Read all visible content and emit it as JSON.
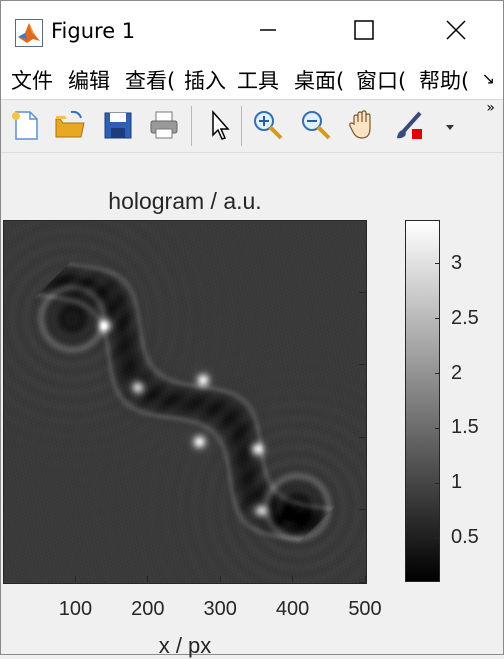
{
  "window": {
    "title": "Figure 1"
  },
  "menubar": {
    "items": [
      "文件",
      "编辑",
      "查看(",
      "插入",
      "工具",
      "桌面(",
      "窗口(",
      "帮助("
    ],
    "more_label": "↘"
  },
  "toolbar": {
    "tools": [
      "new-figure-icon",
      "open-file-icon",
      "save-icon",
      "print-icon",
      "pointer-icon",
      "zoom-in-icon",
      "zoom-out-icon",
      "pan-hand-icon",
      "brush-icon",
      "dropdown-arrow-icon"
    ],
    "more_label": "»"
  },
  "plot": {
    "title": "hologram / a.u.",
    "xlabel": "x / px",
    "x_tick_labels": [
      "100",
      "200",
      "300",
      "400",
      "500"
    ],
    "colorbar_tick_labels": [
      "0.5",
      "1",
      "1.5",
      "2",
      "2.5",
      "3"
    ],
    "colormap": "gray",
    "clim": [
      0.1,
      3.4
    ]
  },
  "chart_data": {
    "type": "heatmap",
    "title": "hologram / a.u.",
    "xlabel": "x / px",
    "ylabel": "",
    "xlim": [
      0,
      500
    ],
    "x_ticks": [
      100,
      200,
      300,
      400,
      500
    ],
    "colorbar": {
      "label": "",
      "ticks": [
        0.5,
        1,
        1.5,
        2,
        2.5,
        3
      ],
      "range": [
        0.1,
        3.4
      ],
      "colormap": "gray"
    }
  },
  "colors": {
    "background": "#f0f0f0",
    "axes": "#262626",
    "plot_bg": "#3c3c3c"
  }
}
